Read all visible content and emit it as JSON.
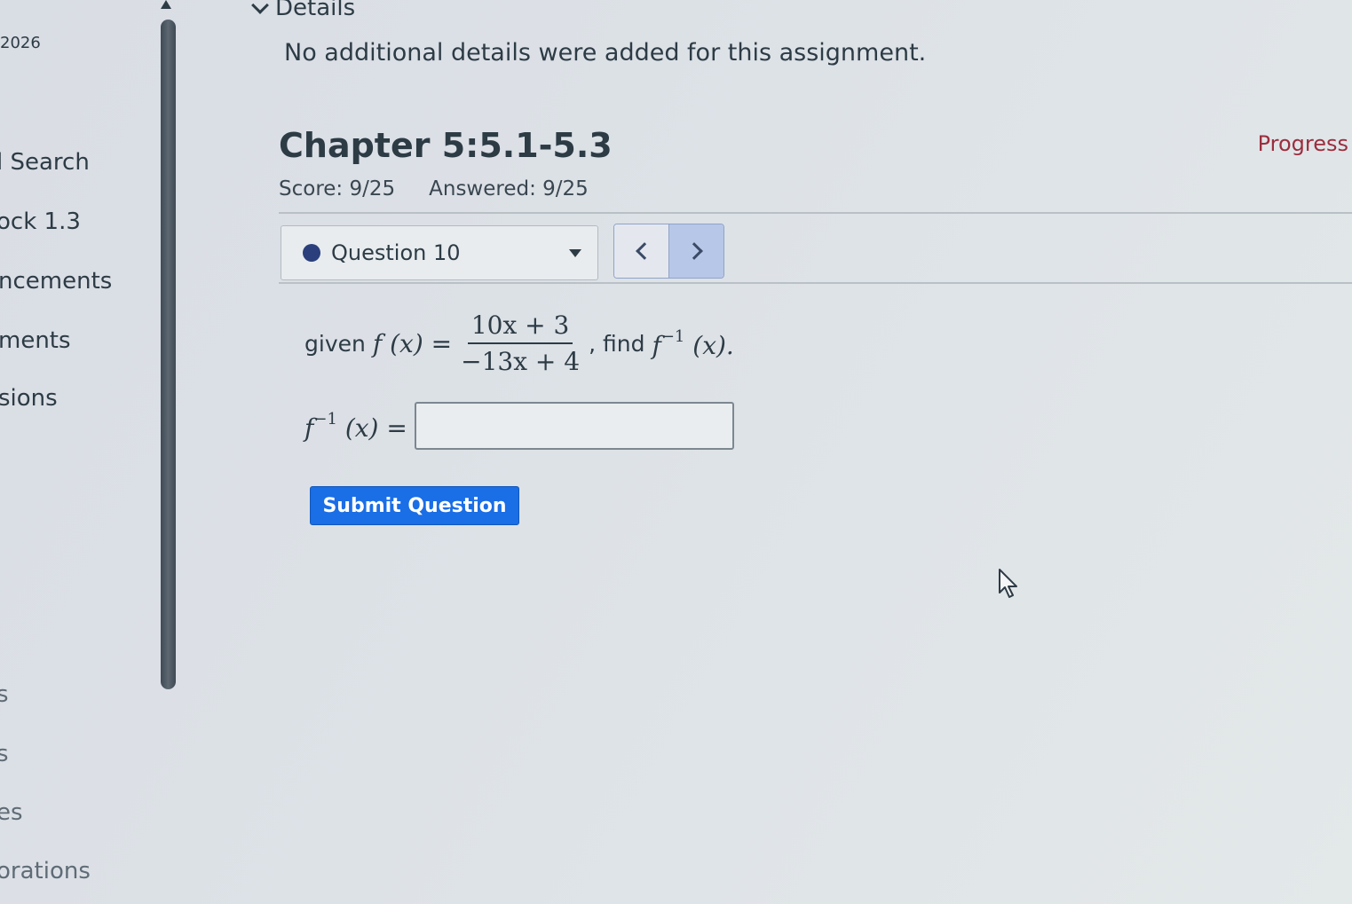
{
  "sidebar": {
    "year_fragment": "2026",
    "items": [
      {
        "label": "l Search"
      },
      {
        "label": "ock 1.3"
      },
      {
        "label": "ncements"
      },
      {
        "label": "ments"
      },
      {
        "label": "sions"
      },
      {
        "label": "s"
      },
      {
        "label": "s"
      },
      {
        "label": "es"
      },
      {
        "label": "orations"
      }
    ]
  },
  "details": {
    "toggle_label": "Details",
    "text": "No additional details were added for this assignment."
  },
  "assignment": {
    "title": "Chapter 5:5.1-5.3",
    "progress_label": "Progress",
    "score": "Score: 9/25",
    "answered": "Answered: 9/25"
  },
  "question_nav": {
    "current": "Question 10",
    "prev_icon": "chevron-left-icon",
    "next_icon": "chevron-right-icon"
  },
  "problem": {
    "given": "given",
    "f_of_x": "f (x) =",
    "numerator": "10x + 3",
    "denominator": "−13x + 4",
    "find": ", find",
    "f": "f",
    "inverse_exp": "−1",
    "x_paren": "(x).",
    "x_paren_eq": "(x) =",
    "answer_value": ""
  },
  "actions": {
    "submit_label": "Submit Question"
  },
  "colors": {
    "submit_bg": "#1a6ee6",
    "progress_link": "#9b2e3e",
    "question_dot": "#2a3f7c",
    "next_button": "#b7c7e8"
  }
}
